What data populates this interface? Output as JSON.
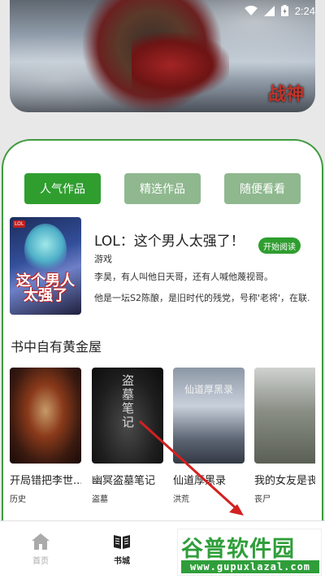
{
  "status_bar": {
    "time": "2:24"
  },
  "banner": {
    "logo_text": "战神"
  },
  "tabs": [
    {
      "label": "人气作品",
      "active": true
    },
    {
      "label": "精选作品",
      "active": false
    },
    {
      "label": "随便看看",
      "active": false
    }
  ],
  "featured": {
    "cover_title": "这个男人太强了",
    "cover_tag": "LOL",
    "title": "LOL：这个男人太强了！",
    "read_button": "开始阅读",
    "genre": "游戏",
    "desc_line1": "李昊，有人叫他日天哥，还有人喊他蔑视哥。",
    "desc_line2": "他是一坛S2陈酿，是旧时代的残党，号称'老将'，在联..."
  },
  "section": {
    "title": "书中自有黄金屋"
  },
  "books": [
    {
      "name": "开局错把李世...",
      "genre": "历史"
    },
    {
      "name": "幽冥盗墓笔记",
      "genre": "盗墓",
      "cover_text": "盗墓笔记"
    },
    {
      "name": "仙道厚黑录",
      "genre": "洪荒",
      "cover_text": "仙道厚黑录"
    },
    {
      "name": "我的女友是丧",
      "genre": "丧尸"
    }
  ],
  "bottom_nav": [
    {
      "label": "首页",
      "icon": "home-icon",
      "active": false
    },
    {
      "label": "书城",
      "icon": "book-icon",
      "active": true
    }
  ],
  "watermark": {
    "main": "谷普软件园",
    "url": "www.gupuxlazal.com"
  },
  "colors": {
    "accent": "#2f9e2f",
    "tab_inactive": "#8fb88f",
    "card_border": "#3f9b3f"
  }
}
